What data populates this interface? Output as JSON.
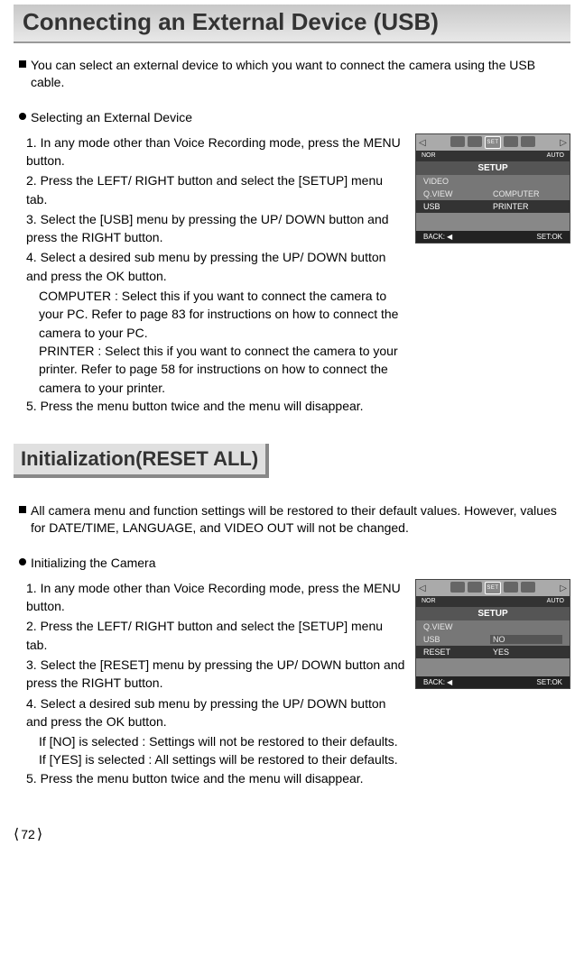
{
  "title": "Connecting an External Device (USB)",
  "intro1": "You can select an external device to which you want to connect the camera using the USB cable.",
  "section1_head": "Selecting an External Device",
  "s1_step1": "1. In any mode other than Voice Recording mode, press the MENU button.",
  "s1_step2": "2. Press the LEFT/ RIGHT button and select the [SETUP] menu tab.",
  "s1_step3": "3. Select the [USB] menu by pressing the UP/ DOWN button and press the RIGHT button.",
  "s1_step4": "4. Select a desired sub menu by pressing the UP/ DOWN button and press the OK button.",
  "s1_computer": "COMPUTER : Select this if you want to connect the camera to your PC. Refer to page 83 for instructions on how to connect the camera to your PC.",
  "s1_printer": "PRINTER      : Select this if you want to connect the camera to your printer. Refer to page 58 for instructions on how to connect the camera to your printer.",
  "s1_step5": "5. Press the menu button twice and the menu will disappear.",
  "subtitle": "Initialization(RESET ALL)",
  "intro2": "All camera menu and function settings will be restored to their default values. However, values for DATE/TIME, LANGUAGE, and VIDEO OUT will not be changed.",
  "section2_head": "Initializing the Camera",
  "s2_step1": "1. In any mode other than Voice Recording mode, press the MENU button.",
  "s2_step2": "2. Press the LEFT/ RIGHT button and select the [SETUP] menu tab.",
  "s2_step3": "3. Select the [RESET] menu by pressing the UP/ DOWN button and press the RIGHT button.",
  "s2_step4": "4. Select a desired sub menu by pressing the UP/ DOWN button and press the OK button.",
  "s2_no": "If [NO] is selected   : Settings will not be restored to their defaults.",
  "s2_yes": "If [YES] is selected : All settings will be restored to their defaults.",
  "s2_step5": "5. Press the menu button twice and the menu will disappear.",
  "screen1": {
    "nor": "NOR",
    "auto": "AUTO",
    "setup": "SETUP",
    "set_label": "SET",
    "row1_l": "VIDEO",
    "row1_r": "",
    "row2_l": "Q.VIEW",
    "row2_r": "COMPUTER",
    "row3_l": "USB",
    "row3_r": "PRINTER",
    "back": "BACK:",
    "setok": "SET:OK"
  },
  "screen2": {
    "nor": "NOR",
    "auto": "AUTO",
    "setup": "SETUP",
    "set_label": "SET",
    "row1_l": "Q.VIEW",
    "row1_r": "",
    "row2_l": "USB",
    "row2_r": "NO",
    "row3_l": "RESET",
    "row3_r": "YES",
    "back": "BACK:",
    "setok": "SET:OK"
  },
  "page_num": "72"
}
